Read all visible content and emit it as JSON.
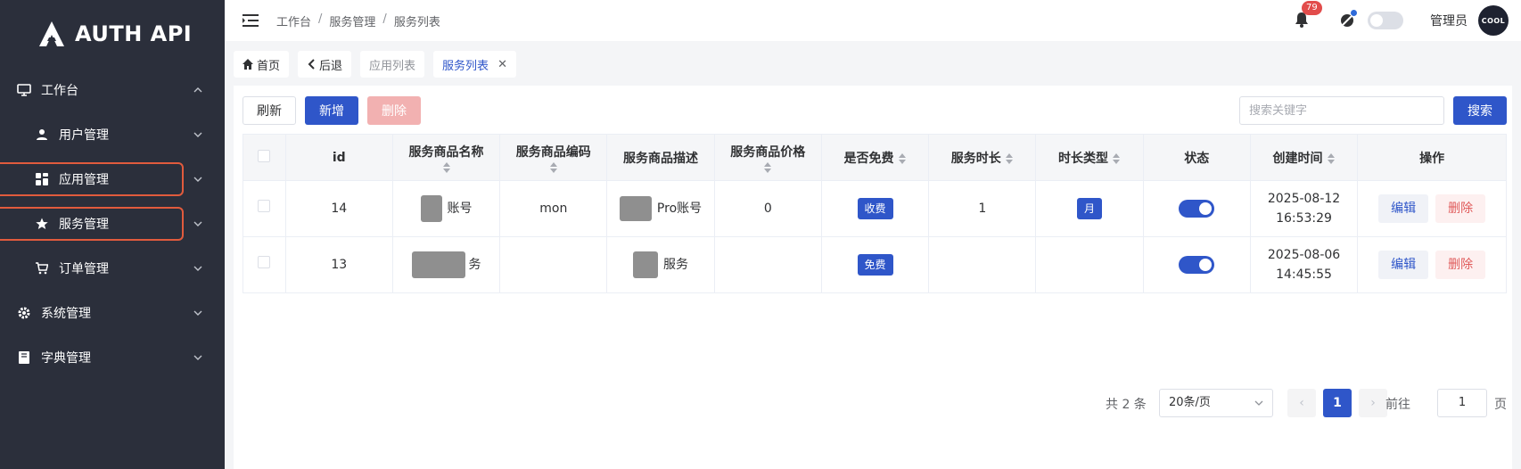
{
  "logo": {
    "text": "AUTH API"
  },
  "sidebar": {
    "items": [
      {
        "label": "工作台",
        "icon": "monitor-icon",
        "expanded": true
      },
      {
        "label": "用户管理",
        "icon": "user-icon"
      },
      {
        "label": "应用管理",
        "icon": "apps-icon"
      },
      {
        "label": "服务管理",
        "icon": "star-icon"
      },
      {
        "label": "订单管理",
        "icon": "cart-icon"
      },
      {
        "label": "系统管理",
        "icon": "gear-icon"
      },
      {
        "label": "字典管理",
        "icon": "book-icon"
      }
    ]
  },
  "header": {
    "breadcrumb": [
      "工作台",
      "服务管理",
      "服务列表"
    ],
    "notification_count": "79",
    "admin_name": "管理员",
    "avatar_text": "COOL"
  },
  "tabs": [
    {
      "label": "首页"
    },
    {
      "label": "后退"
    },
    {
      "label": "应用列表"
    },
    {
      "label": "服务列表"
    }
  ],
  "toolbar": {
    "refresh_label": "刷新",
    "add_label": "新增",
    "delete_label": "删除",
    "search_placeholder": "搜索关键字",
    "search_label": "搜索"
  },
  "table": {
    "columns": [
      "id",
      "服务商品名称",
      "服务商品编码",
      "服务商品描述",
      "服务商品价格",
      "是否免费",
      "服务时长",
      "时长类型",
      "状态",
      "创建时间",
      "操作"
    ],
    "rows": [
      {
        "id": "14",
        "name": "账号",
        "code": "mon",
        "desc": "Pro账号",
        "price": "0",
        "free": "收费",
        "duration": "1",
        "duration_type": "月",
        "created_date": "2025-08-12",
        "created_time": "16:53:29",
        "edit": "编辑",
        "delete": "删除"
      },
      {
        "id": "13",
        "name": "务",
        "code": "",
        "desc": "服务",
        "price": "",
        "free": "免费",
        "duration": "",
        "duration_type": "",
        "created_date": "2025-08-06",
        "created_time": "14:45:55",
        "edit": "编辑",
        "delete": "删除"
      }
    ]
  },
  "pagination": {
    "total": "共 2 条",
    "page_size": "20条/页",
    "current_page": "1",
    "goto_label": "前往",
    "goto_value": "1",
    "page_suffix": "页"
  },
  "colors": {
    "primary": "#2f56c9",
    "sidebar_bg": "#2b2f3b",
    "danger": "#e05b5b",
    "highlight_border": "#e15b3d"
  }
}
